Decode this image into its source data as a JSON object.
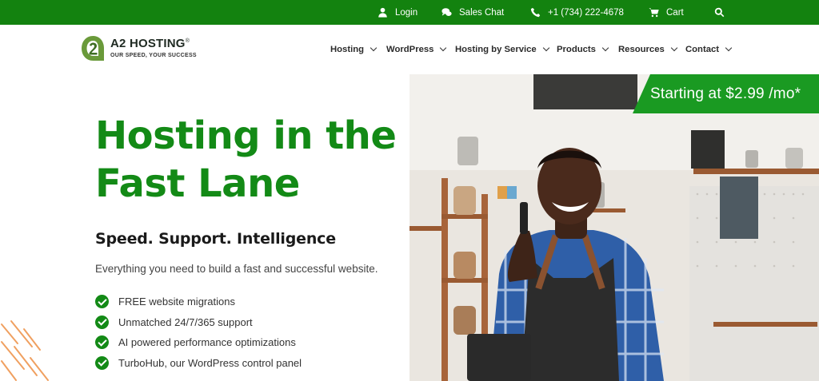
{
  "topbar": {
    "login": "Login",
    "sales_chat": "Sales Chat",
    "phone": "+1 (734) 222-4678",
    "cart": "Cart"
  },
  "logo": {
    "name": "A2 HOSTING",
    "registered": "®",
    "tagline": "OUR SPEED, YOUR SUCCESS"
  },
  "nav": {
    "items": [
      {
        "label": "Hosting"
      },
      {
        "label": "WordPress"
      },
      {
        "label": "Hosting by Service"
      },
      {
        "label": "Products"
      },
      {
        "label": "Resources"
      },
      {
        "label": "Contact"
      }
    ]
  },
  "hero": {
    "title": "Hosting in the Fast Lane",
    "subtitle": "Speed. Support. Intelligence",
    "description": "Everything you need to build a fast and successful website.",
    "features": [
      "FREE website migrations",
      "Unmatched 24/7/365 support",
      "AI powered performance optimizations",
      "TurboHub, our WordPress control panel"
    ],
    "price_banner": "Starting at $2.99 /mo*"
  },
  "colors": {
    "brand_green": "#13820f",
    "title_green": "#138a16",
    "banner_green": "#1a9a22",
    "accent_orange": "#f0a060"
  },
  "icons": [
    "user-icon",
    "chat-icon",
    "phone-icon",
    "cart-icon",
    "search-icon",
    "check-icon",
    "chevron-down-icon"
  ]
}
